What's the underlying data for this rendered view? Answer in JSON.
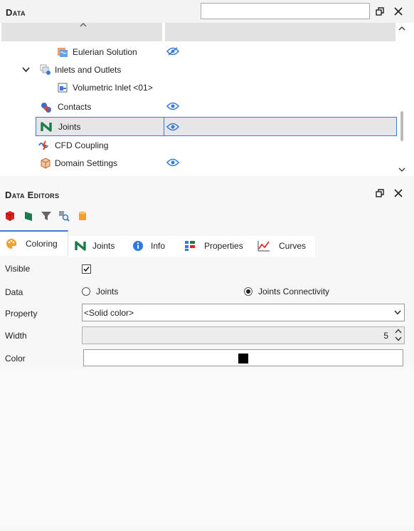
{
  "data_panel": {
    "title": "Data",
    "search_value": "",
    "tree": [
      {
        "label": "Eulerian Solution",
        "icon": "eulerian-solution-icon",
        "visible_toggle": "hidden-eye"
      },
      {
        "label": "Inlets and Outlets",
        "icon": "inlets-outlets-icon"
      },
      {
        "label": "Volumetric Inlet <01>",
        "icon": "volumetric-inlet-icon"
      },
      {
        "label": "Contacts",
        "icon": "contacts-icon",
        "visible_toggle": "eye"
      },
      {
        "label": "Joints",
        "icon": "joints-icon",
        "visible_toggle": "eye",
        "selected": true
      },
      {
        "label": "CFD Coupling",
        "icon": "cfd-coupling-icon"
      },
      {
        "label": "Domain Settings",
        "icon": "domain-settings-icon",
        "visible_toggle": "eye"
      }
    ]
  },
  "editors_panel": {
    "title": "Data Editors",
    "tabs": [
      {
        "label": "Coloring",
        "icon": "palette-icon",
        "active": true
      },
      {
        "label": "Joints",
        "icon": "joints-icon"
      },
      {
        "label": "Info",
        "icon": "info-icon"
      },
      {
        "label": "Properties",
        "icon": "properties-icon"
      },
      {
        "label": "Curves",
        "icon": "curves-icon"
      }
    ],
    "form": {
      "visible_label": "Visible",
      "visible_checked": true,
      "data_label": "Data",
      "data_options": [
        "Joints",
        "Joints Connectivity"
      ],
      "data_selected": "Joints Connectivity",
      "property_label": "Property",
      "property_value": "<Solid color>",
      "width_label": "Width",
      "width_value": "5",
      "color_label": "Color",
      "color_value": "#000000"
    }
  },
  "colors": {
    "accent": "#3a7bd5",
    "selected_row": "#e6e6e6",
    "eye": "#3a7bd5"
  }
}
